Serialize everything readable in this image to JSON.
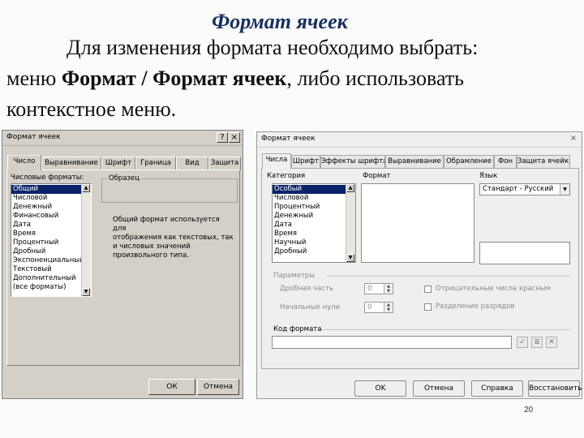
{
  "slide": {
    "title": "Формат ячеек",
    "line1": "Для изменения формата необходимо выбрать:",
    "line2_a": "меню ",
    "line2_b": "Формат / Формат ячеек",
    "line2_c": ", либо использовать",
    "line3": "контекстное меню.",
    "page_number": "20"
  },
  "left_dialog": {
    "title": "Формат ячеек",
    "tabs": [
      "Число",
      "Выравнивание",
      "Шрифт",
      "Граница",
      "Вид",
      "Защита"
    ],
    "active_tab": "Число",
    "formats_label": "Числовые форматы:",
    "formats": [
      "Общий",
      "Числовой",
      "Денежный",
      "Финансовый",
      "Дата",
      "Время",
      "Процентный",
      "Дробный",
      "Экспоненциальный",
      "Текстовый",
      "Дополнительный",
      "(все форматы)"
    ],
    "selected_format": "Общий",
    "sample_label": "Образец",
    "description": [
      "Общий формат используется для",
      "отображения как текстовых, так",
      "и числовых значений",
      "произвольного типа."
    ],
    "ok_label": "ОК",
    "cancel_label": "Отмена",
    "help_label": "?",
    "close_label": "×"
  },
  "right_dialog": {
    "title": "Формат ячеек",
    "tabs": [
      "Числа",
      "Шрифт",
      "Эффекты шрифта",
      "Выравнивание",
      "Обрамление",
      "Фон",
      "Защита ячейки"
    ],
    "active_tab": "Числа",
    "category_label": "Категория",
    "categories": [
      "Особый",
      "Числовой",
      "Процентный",
      "Денежный",
      "Дата",
      "Время",
      "Научный",
      "Дробный"
    ],
    "selected_category": "Особый",
    "format_label": "Формат",
    "language_label": "Язык",
    "language_value": "Стандарт - Русский",
    "params_label": "Параметры",
    "decimal_label": "Дробная часть",
    "decimal_value": "0",
    "leading_zeros_label": "Начальные нули",
    "leading_zeros_value": "0",
    "negative_red_label": "Отрицательные числа красным",
    "thousands_sep_label": "Разделение разрядов",
    "format_code_label": "Код формата",
    "ok_label": "OK",
    "cancel_label": "Отмена",
    "help_label": "Справка",
    "reset_label": "Восстановить",
    "close_label": "×"
  }
}
